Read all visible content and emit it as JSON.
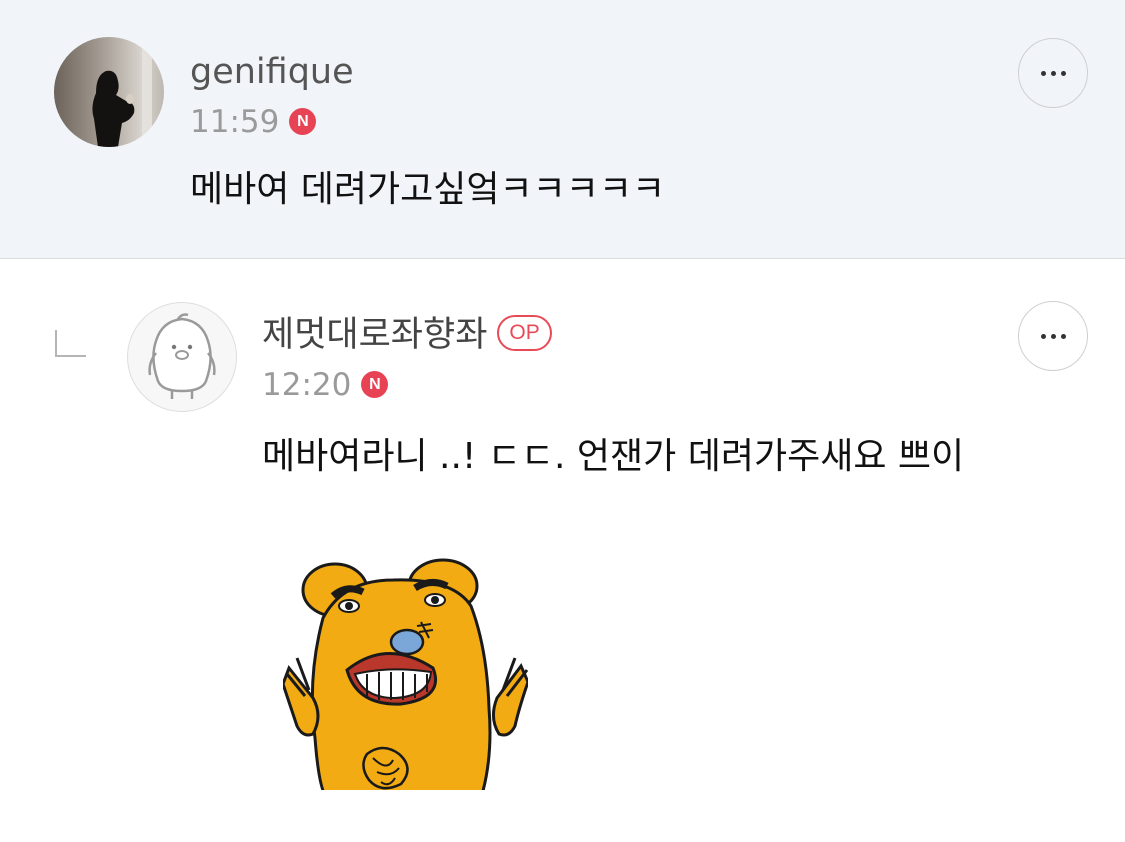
{
  "comments": [
    {
      "author": "genifique",
      "time": "11:59",
      "new_badge": "N",
      "text": "메바여 데려가고싶엌ㅋㅋㅋㅋㅋ",
      "more_icon": "more-horizontal-icon"
    },
    {
      "author": "제멋대로좌향좌",
      "author_badge": "OP",
      "time": "12:20",
      "new_badge": "N",
      "text": "메바여라니 ..! ㄷㄷ. 언잰가 데려가주새요 쁘이",
      "reply_icon": "reply-arrow-icon",
      "avatar_icon": "default-penguin-avatar",
      "sticker": "yellow-bear-sticker",
      "more_icon": "more-horizontal-icon"
    }
  ],
  "colors": {
    "highlight_bg": "#f1f5fa",
    "badge_red": "#e84355",
    "op_red": "#e84b57",
    "time_gray": "#9a9a9a"
  }
}
